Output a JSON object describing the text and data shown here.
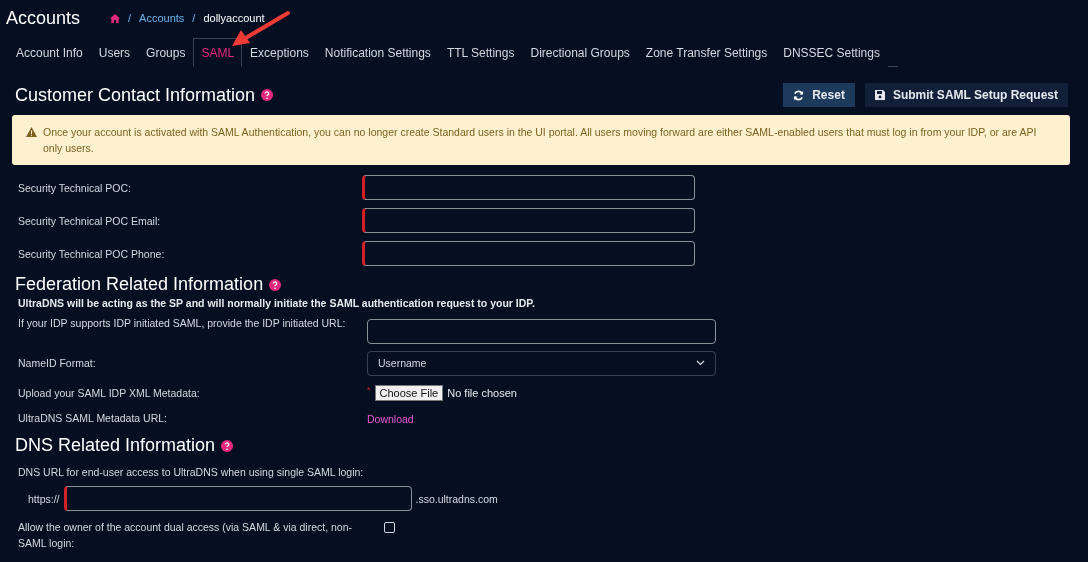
{
  "header": {
    "title": "Accounts",
    "breadcrumb": [
      {
        "separator": "/",
        "label": "Accounts",
        "kind": "link"
      },
      {
        "separator": "/",
        "label": "dollyaccount",
        "kind": "current"
      }
    ]
  },
  "tabs": [
    {
      "label": "Account Info",
      "selected": false
    },
    {
      "label": "Users",
      "selected": false
    },
    {
      "label": "Groups",
      "selected": false
    },
    {
      "label": "SAML",
      "selected": true
    },
    {
      "label": "Exceptions",
      "selected": false
    },
    {
      "label": "Notification Settings",
      "selected": false
    },
    {
      "label": "TTL Settings",
      "selected": false
    },
    {
      "label": "Directional Groups",
      "selected": false
    },
    {
      "label": "Zone Transfer Settings",
      "selected": false
    },
    {
      "label": "DNSSEC Settings",
      "selected": false
    }
  ],
  "contact": {
    "title": "Customer Contact Information",
    "buttons": [
      {
        "label": "Reset",
        "kind": "reset"
      },
      {
        "label": "Submit SAML Setup Request",
        "kind": "submit"
      }
    ],
    "alert": "Once your account is activated with SAML Authentication, you can no longer create Standard users in the UI portal. All users moving forward are either SAML-enabled users that must log in from your IDP, or are API only users.",
    "fields": [
      {
        "label": "Security Technical POC:",
        "required": true
      },
      {
        "label": "Security Technical POC Email:",
        "required": true
      },
      {
        "label": "Security Technical POC Phone:",
        "required": true
      }
    ]
  },
  "federation": {
    "title": "Federation Related Information",
    "note": "UltraDNS will be acting as the SP and will normally initiate the SAML authentication request to your IDP.",
    "rows": [
      {
        "kind": "text",
        "label": "If your IDP supports IDP initiated SAML, provide the IDP initiated URL:"
      },
      {
        "kind": "select",
        "label": "NameID Format:",
        "value": "Username"
      },
      {
        "kind": "file",
        "label": "Upload your SAML IDP XML Metadata:",
        "button": "Choose File",
        "status": "No file chosen",
        "required_mark": "*"
      },
      {
        "kind": "link",
        "label": "UltraDNS SAML Metadata URL:",
        "link": "Download"
      }
    ]
  },
  "dns": {
    "title": "DNS Related Information",
    "url_label": "DNS URL for end-user access to UltraDNS when using single SAML login:",
    "prefix": "https://",
    "suffix": ".sso.ultradns.com",
    "required": true,
    "dual_access": {
      "label": "Allow the owner of the account dual access (via SAML & via direct, non-SAML login:",
      "checked": false
    }
  }
}
